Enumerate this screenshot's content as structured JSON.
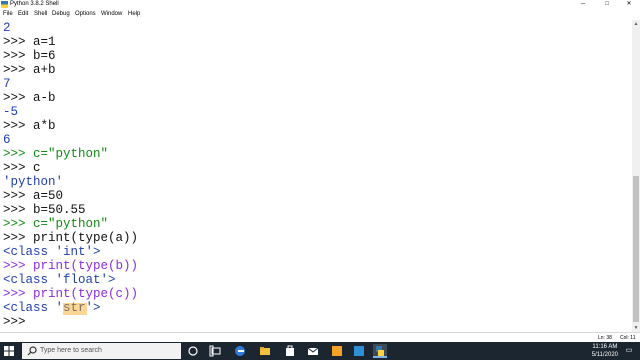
{
  "window": {
    "title": "Python 3.8.2 Shell",
    "controls": {
      "minimize": "─",
      "maximize": "□",
      "close": "✕"
    }
  },
  "menu": [
    "File",
    "Edit",
    "Shell",
    "Debug",
    "Options",
    "Window",
    "Help"
  ],
  "shell_lines": [
    "2",
    ">>> a=1",
    ">>> b=6",
    ">>> a+b",
    "7",
    ">>> a-b",
    "-5",
    ">>> a*b",
    "6",
    ">>> c=\"python\"",
    ">>> c",
    "'python'",
    ">>> a=50",
    ">>> b=50.55",
    ">>> c=\"python\"",
    ">>> print(type(a))",
    "<class 'int'>",
    ">>> print(type(b))",
    "<class 'float'>",
    ">>> print(type(c))",
    "<class 'str'>",
    ">>> "
  ],
  "statusbar": {
    "ln": "Ln: 38",
    "col": "Col: 11"
  },
  "taskbar": {
    "search_placeholder": "Type here to search",
    "time": "11:16 AM",
    "date": "5/11/2020"
  },
  "colors": {
    "output": "#1f3fb0",
    "string": "#138a13",
    "selection": "#f3a712",
    "taskbar": "#1c2630"
  }
}
